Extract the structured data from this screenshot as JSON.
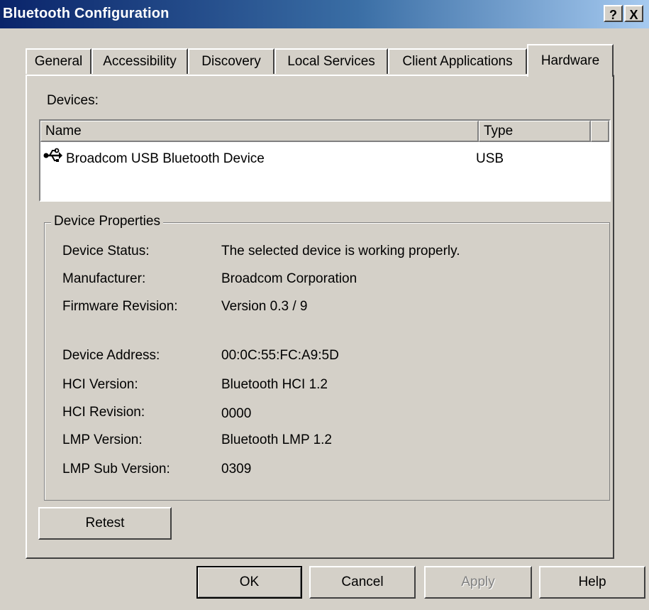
{
  "window": {
    "title": "Bluetooth Configuration",
    "help_button": "?",
    "close_button": "X"
  },
  "tabs": [
    {
      "label": "General",
      "active": false
    },
    {
      "label": "Accessibility",
      "active": false
    },
    {
      "label": "Discovery",
      "active": false
    },
    {
      "label": "Local Services",
      "active": false
    },
    {
      "label": "Client Applications",
      "active": false
    },
    {
      "label": "Hardware",
      "active": true
    }
  ],
  "devices": {
    "label": "Devices:",
    "columns": [
      "Name",
      "Type"
    ],
    "rows": [
      {
        "icon": "usb-icon",
        "name": "Broadcom USB Bluetooth Device",
        "type": "USB"
      }
    ]
  },
  "properties": {
    "title": "Device Properties",
    "items": [
      {
        "label": "Device Status:",
        "value": "The selected device is working properly."
      },
      {
        "label": "Manufacturer:",
        "value": "Broadcom Corporation"
      },
      {
        "label": "Firmware Revision:",
        "value": "Version 0.3 / 9"
      },
      {
        "label": "Device Address:",
        "value": "00:0C:55:FC:A9:5D"
      },
      {
        "label": "HCI Version:",
        "value": "Bluetooth HCI 1.2"
      },
      {
        "label": "HCI Revision:",
        "value": "0000"
      },
      {
        "label": "LMP Version:",
        "value": "Bluetooth LMP 1.2"
      },
      {
        "label": "LMP Sub Version:",
        "value": "0309"
      }
    ]
  },
  "buttons": {
    "retest": "Retest",
    "ok": "OK",
    "cancel": "Cancel",
    "apply": "Apply",
    "help": "Help"
  }
}
